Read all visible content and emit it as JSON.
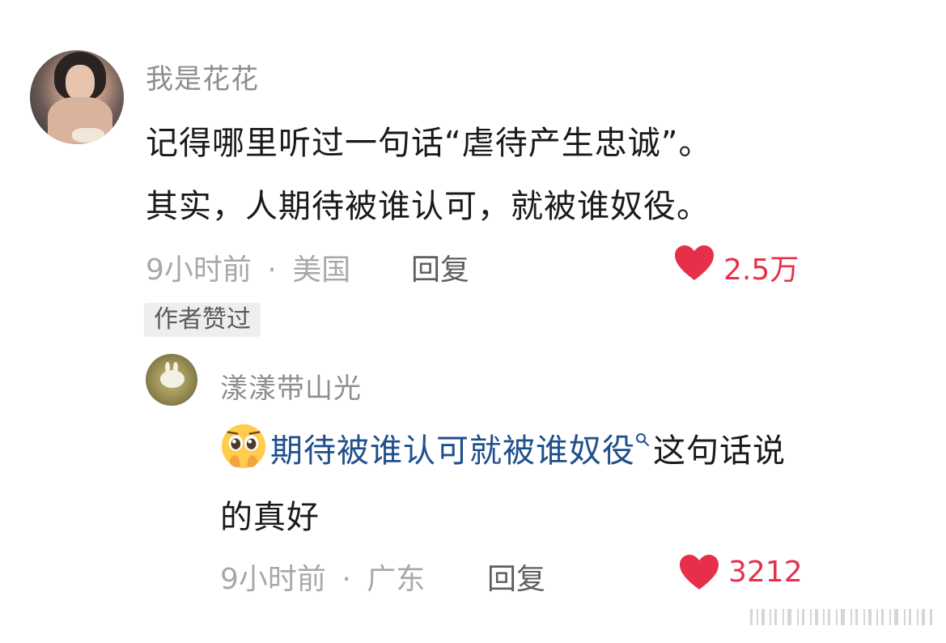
{
  "main_comment": {
    "username": "我是花花",
    "lines": [
      "记得哪里听过一句话“虐待产生忠诚”。",
      "其实，人期待被谁认可，就被谁奴役。"
    ],
    "time": "9小时前",
    "location": "美国",
    "separator": "·",
    "reply_label": "回复",
    "likes": "2.5万",
    "author_badge": "作者赞过"
  },
  "reply_comment": {
    "username": "漾漾带山光",
    "emoji": "pleading-face-emoji",
    "link_text": "期待被谁认可就被谁奴役",
    "text_after_link": "这句话说",
    "text_line2": "的真好",
    "time": "9小时前",
    "location": "广东",
    "separator": "·",
    "reply_label": "回复",
    "likes": "3212"
  },
  "colors": {
    "like_red": "#e6304a",
    "link_blue": "#1f4f8c",
    "meta_gray": "#a8a8a8",
    "username_gray": "#8e8e8e"
  },
  "icons": {
    "like": "heart-icon",
    "search": "search-icon",
    "watermark": "barcode-watermark"
  }
}
